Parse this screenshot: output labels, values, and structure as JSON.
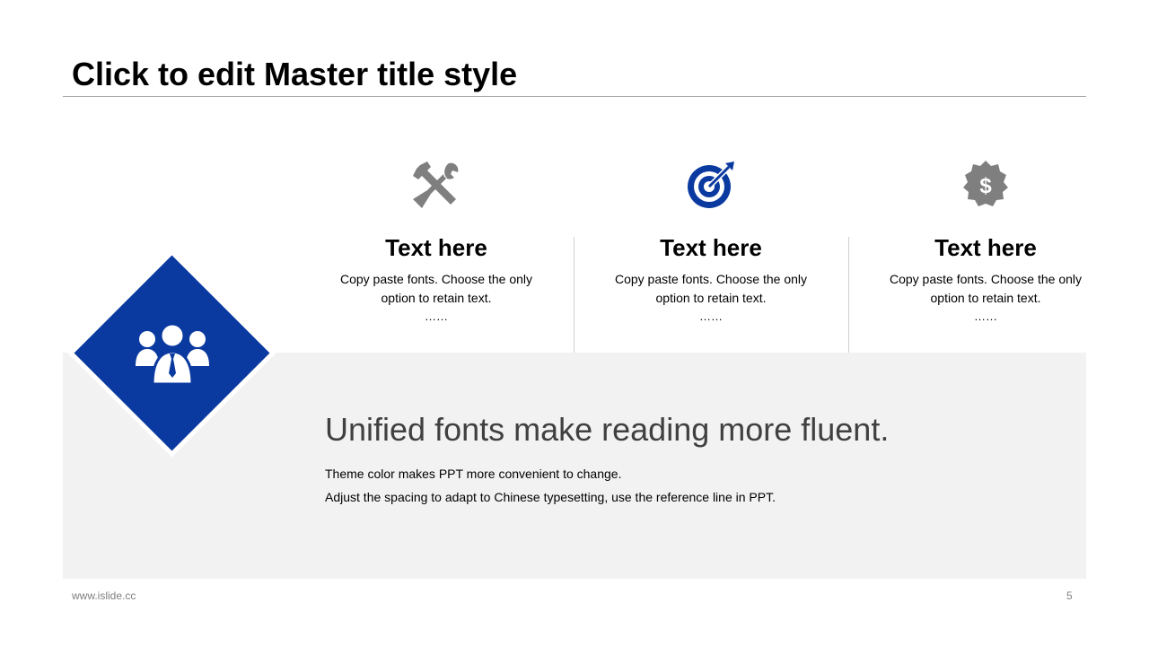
{
  "slide": {
    "title": "Click to edit Master title style",
    "colors": {
      "accent": "#0a3aa0",
      "icon_grey": "#7f7f7f",
      "panel": "#f2f2f2",
      "headline": "#404040"
    }
  },
  "features": [
    {
      "icon": "tools-icon",
      "title": "Text here",
      "desc": "Copy paste fonts. Choose the only option to retain text.",
      "more": "……"
    },
    {
      "icon": "target-icon",
      "title": "Text here",
      "desc": "Copy paste fonts. Choose the only option to retain text.",
      "more": "……"
    },
    {
      "icon": "dollar-badge-icon",
      "title": "Text here",
      "desc": "Copy paste fonts. Choose the only option to retain text.",
      "more": "……"
    }
  ],
  "highlight": {
    "icon": "team-icon",
    "headline": "Unified fonts make reading more fluent.",
    "line1": "Theme color makes PPT more convenient  to change.",
    "line2": "Adjust  the  spacing  to adapt  to Chinese  typesetting,  use  the  reference  line  in  PPT."
  },
  "footer": {
    "url": "www.islide.cc",
    "page": "5"
  }
}
